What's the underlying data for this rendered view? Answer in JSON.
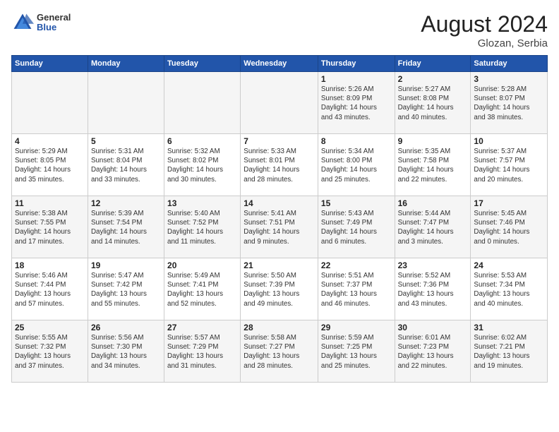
{
  "header": {
    "logo_general": "General",
    "logo_blue": "Blue",
    "month_year": "August 2024",
    "location": "Glozan, Serbia"
  },
  "days_of_week": [
    "Sunday",
    "Monday",
    "Tuesday",
    "Wednesday",
    "Thursday",
    "Friday",
    "Saturday"
  ],
  "weeks": [
    [
      {
        "day": "",
        "info": ""
      },
      {
        "day": "",
        "info": ""
      },
      {
        "day": "",
        "info": ""
      },
      {
        "day": "",
        "info": ""
      },
      {
        "day": "1",
        "info": "Sunrise: 5:26 AM\nSunset: 8:09 PM\nDaylight: 14 hours\nand 43 minutes."
      },
      {
        "day": "2",
        "info": "Sunrise: 5:27 AM\nSunset: 8:08 PM\nDaylight: 14 hours\nand 40 minutes."
      },
      {
        "day": "3",
        "info": "Sunrise: 5:28 AM\nSunset: 8:07 PM\nDaylight: 14 hours\nand 38 minutes."
      }
    ],
    [
      {
        "day": "4",
        "info": "Sunrise: 5:29 AM\nSunset: 8:05 PM\nDaylight: 14 hours\nand 35 minutes."
      },
      {
        "day": "5",
        "info": "Sunrise: 5:31 AM\nSunset: 8:04 PM\nDaylight: 14 hours\nand 33 minutes."
      },
      {
        "day": "6",
        "info": "Sunrise: 5:32 AM\nSunset: 8:02 PM\nDaylight: 14 hours\nand 30 minutes."
      },
      {
        "day": "7",
        "info": "Sunrise: 5:33 AM\nSunset: 8:01 PM\nDaylight: 14 hours\nand 28 minutes."
      },
      {
        "day": "8",
        "info": "Sunrise: 5:34 AM\nSunset: 8:00 PM\nDaylight: 14 hours\nand 25 minutes."
      },
      {
        "day": "9",
        "info": "Sunrise: 5:35 AM\nSunset: 7:58 PM\nDaylight: 14 hours\nand 22 minutes."
      },
      {
        "day": "10",
        "info": "Sunrise: 5:37 AM\nSunset: 7:57 PM\nDaylight: 14 hours\nand 20 minutes."
      }
    ],
    [
      {
        "day": "11",
        "info": "Sunrise: 5:38 AM\nSunset: 7:55 PM\nDaylight: 14 hours\nand 17 minutes."
      },
      {
        "day": "12",
        "info": "Sunrise: 5:39 AM\nSunset: 7:54 PM\nDaylight: 14 hours\nand 14 minutes."
      },
      {
        "day": "13",
        "info": "Sunrise: 5:40 AM\nSunset: 7:52 PM\nDaylight: 14 hours\nand 11 minutes."
      },
      {
        "day": "14",
        "info": "Sunrise: 5:41 AM\nSunset: 7:51 PM\nDaylight: 14 hours\nand 9 minutes."
      },
      {
        "day": "15",
        "info": "Sunrise: 5:43 AM\nSunset: 7:49 PM\nDaylight: 14 hours\nand 6 minutes."
      },
      {
        "day": "16",
        "info": "Sunrise: 5:44 AM\nSunset: 7:47 PM\nDaylight: 14 hours\nand 3 minutes."
      },
      {
        "day": "17",
        "info": "Sunrise: 5:45 AM\nSunset: 7:46 PM\nDaylight: 14 hours\nand 0 minutes."
      }
    ],
    [
      {
        "day": "18",
        "info": "Sunrise: 5:46 AM\nSunset: 7:44 PM\nDaylight: 13 hours\nand 57 minutes."
      },
      {
        "day": "19",
        "info": "Sunrise: 5:47 AM\nSunset: 7:42 PM\nDaylight: 13 hours\nand 55 minutes."
      },
      {
        "day": "20",
        "info": "Sunrise: 5:49 AM\nSunset: 7:41 PM\nDaylight: 13 hours\nand 52 minutes."
      },
      {
        "day": "21",
        "info": "Sunrise: 5:50 AM\nSunset: 7:39 PM\nDaylight: 13 hours\nand 49 minutes."
      },
      {
        "day": "22",
        "info": "Sunrise: 5:51 AM\nSunset: 7:37 PM\nDaylight: 13 hours\nand 46 minutes."
      },
      {
        "day": "23",
        "info": "Sunrise: 5:52 AM\nSunset: 7:36 PM\nDaylight: 13 hours\nand 43 minutes."
      },
      {
        "day": "24",
        "info": "Sunrise: 5:53 AM\nSunset: 7:34 PM\nDaylight: 13 hours\nand 40 minutes."
      }
    ],
    [
      {
        "day": "25",
        "info": "Sunrise: 5:55 AM\nSunset: 7:32 PM\nDaylight: 13 hours\nand 37 minutes."
      },
      {
        "day": "26",
        "info": "Sunrise: 5:56 AM\nSunset: 7:30 PM\nDaylight: 13 hours\nand 34 minutes."
      },
      {
        "day": "27",
        "info": "Sunrise: 5:57 AM\nSunset: 7:29 PM\nDaylight: 13 hours\nand 31 minutes."
      },
      {
        "day": "28",
        "info": "Sunrise: 5:58 AM\nSunset: 7:27 PM\nDaylight: 13 hours\nand 28 minutes."
      },
      {
        "day": "29",
        "info": "Sunrise: 5:59 AM\nSunset: 7:25 PM\nDaylight: 13 hours\nand 25 minutes."
      },
      {
        "day": "30",
        "info": "Sunrise: 6:01 AM\nSunset: 7:23 PM\nDaylight: 13 hours\nand 22 minutes."
      },
      {
        "day": "31",
        "info": "Sunrise: 6:02 AM\nSunset: 7:21 PM\nDaylight: 13 hours\nand 19 minutes."
      }
    ]
  ]
}
